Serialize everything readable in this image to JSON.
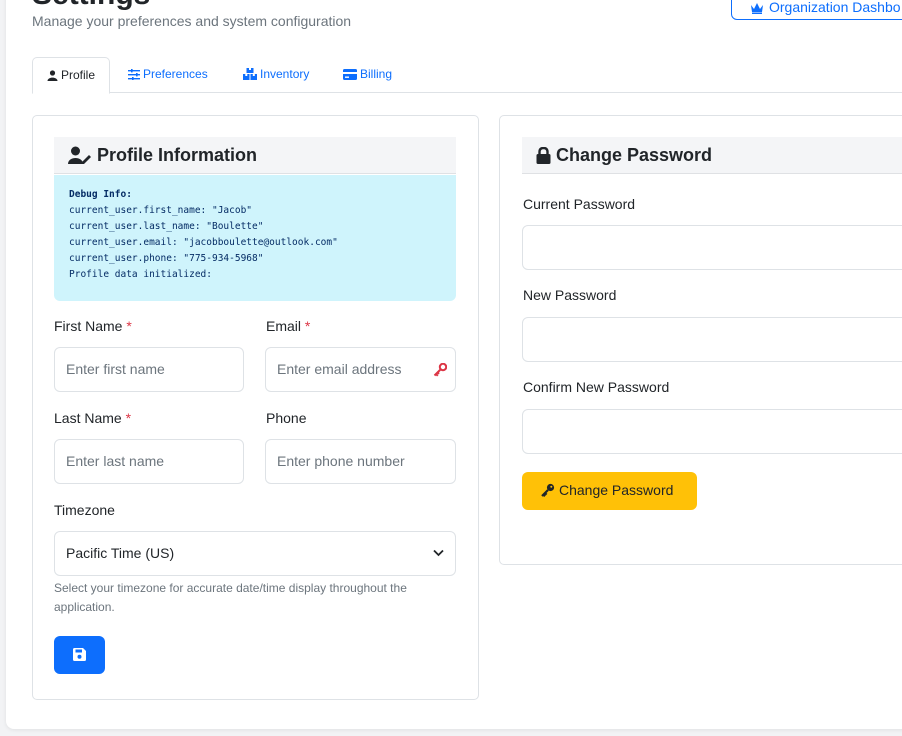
{
  "header": {
    "title": "Settings",
    "subtitle": "Manage your preferences and system configuration",
    "org_button": "Organization Dashbo"
  },
  "tabs": [
    {
      "label": "Profile",
      "icon": "user-icon",
      "active": true
    },
    {
      "label": "Preferences",
      "icon": "sliders-icon",
      "active": false
    },
    {
      "label": "Inventory",
      "icon": "boxes-icon",
      "active": false
    },
    {
      "label": "Billing",
      "icon": "credit-card-icon",
      "active": false
    }
  ],
  "profile": {
    "title": "Profile Information",
    "debug": {
      "title": "Debug Info:",
      "lines": [
        "current_user.first_name: \"Jacob\"",
        "current_user.last_name: \"Boulette\"",
        "current_user.email: \"jacobboulette@outlook.com\"",
        "current_user.phone: \"775-934-5968\"",
        "Profile data initialized:"
      ]
    },
    "first_name": {
      "label": "First Name",
      "required": "*",
      "placeholder": "Enter first name"
    },
    "email": {
      "label": "Email",
      "required": "*",
      "placeholder": "Enter email address"
    },
    "last_name": {
      "label": "Last Name",
      "required": "*",
      "placeholder": "Enter last name"
    },
    "phone": {
      "label": "Phone",
      "placeholder": "Enter phone number"
    },
    "timezone": {
      "label": "Timezone",
      "value": "Pacific Time (US)",
      "help": "Select your timezone for accurate date/time display throughout the application."
    }
  },
  "password": {
    "title": "Change Password",
    "current_label": "Current Password",
    "new_label": "New Password",
    "confirm_label": "Confirm New Password",
    "button": "Change Password"
  },
  "colors": {
    "primary": "#0d6efd",
    "warning": "#ffc107",
    "info_bg": "#cff4fc",
    "danger": "#dc3545"
  }
}
